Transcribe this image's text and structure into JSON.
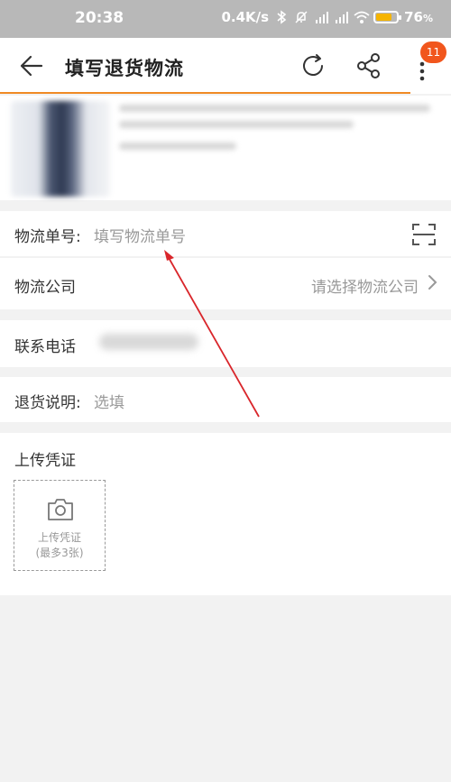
{
  "status_bar": {
    "time": "20:38",
    "network_speed": "0.4K/s",
    "battery_percent": "76",
    "battery_unit": "%",
    "battery_level": 0.76,
    "icons": [
      "bluetooth-icon",
      "mute-icon",
      "hd-signal-icon",
      "hd-signal-icon",
      "wifi-icon",
      "battery-icon"
    ]
  },
  "nav": {
    "title": "填写退货物流",
    "badge_count": "11",
    "icons": [
      "back-arrow-icon",
      "refresh-icon",
      "share-icon",
      "more-vertical-icon"
    ]
  },
  "form": {
    "tracking_label": "物流单号:",
    "tracking_placeholder": "填写物流单号",
    "company_label": "物流公司",
    "company_placeholder": "请选择物流公司",
    "phone_label": "联系电话",
    "note_label": "退货说明:",
    "note_placeholder": "选填"
  },
  "upload": {
    "title": "上传凭证",
    "box_label": "上传凭证",
    "box_hint": "(最多3张)"
  },
  "colors": {
    "accent": "#f08a24",
    "badge": "#f1561d",
    "annotation_arrow": "#d9262b",
    "status_bar_bg": "#b8b8b8"
  }
}
